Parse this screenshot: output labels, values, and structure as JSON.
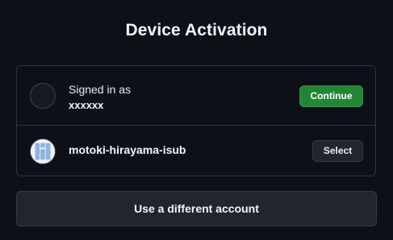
{
  "page": {
    "title": "Device Activation"
  },
  "accounts": {
    "current": {
      "signed_in_label": "Signed in as",
      "username": "xxxxxx",
      "action_label": "Continue"
    },
    "other": {
      "username": "motoki-hirayama-isub",
      "action_label": "Select"
    }
  },
  "different_account_label": "Use a different account",
  "icons": {
    "current_avatar": "avatar-placeholder",
    "other_avatar": "identicon-avatar"
  },
  "colors": {
    "background": "#0d1117",
    "primary_button": "#238636",
    "secondary_button": "#21262d",
    "border": "#30363d"
  }
}
